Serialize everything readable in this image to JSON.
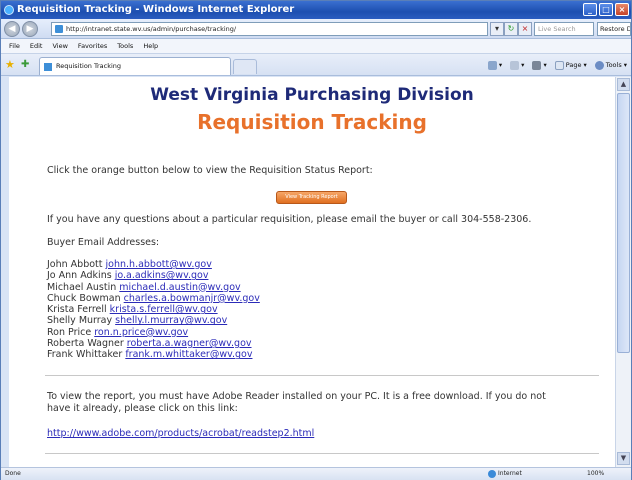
{
  "window": {
    "title": "Requisition Tracking - Windows Internet Explorer"
  },
  "address_bar": {
    "url": "http://intranet.state.wv.us/admin/purchase/tracking/",
    "search_placeholder": "Live Search",
    "restore_label": "Restore Do"
  },
  "menu": [
    "File",
    "Edit",
    "View",
    "Favorites",
    "Tools",
    "Help"
  ],
  "tab": {
    "label": "Requisition Tracking"
  },
  "command_bar": {
    "page_label": "Page",
    "tools_label": "Tools"
  },
  "page": {
    "org_title": "West Virginia Purchasing Division",
    "heading": "Requisition Tracking",
    "instruction": "Click the orange button below to view the Requisition Status Report:",
    "report_button": "View Tracking Report",
    "question_text": "If you have any questions about a particular requisition,  please email the buyer or call 304-558-2306.",
    "buyers_heading": "Buyer Email Addresses:",
    "buyers": [
      {
        "name": "John Abbott",
        "email": "john.h.abbott@wv.gov"
      },
      {
        "name": "Jo Ann Adkins",
        "email": "jo.a.adkins@wv.gov"
      },
      {
        "name": "Michael Austin",
        "email": "michael.d.austin@wv.gov"
      },
      {
        "name": "Chuck Bowman",
        "email": "charles.a.bowmanjr@wv.gov"
      },
      {
        "name": "Krista Ferrell",
        "email": "krista.s.ferrell@wv.gov"
      },
      {
        "name": "Shelly Murray",
        "email": "shelly.l.murray@wv.gov"
      },
      {
        "name": "Ron Price",
        "email": "ron.n.price@wv.gov"
      },
      {
        "name": "Roberta Wagner",
        "email": "roberta.a.wagner@wv.gov"
      },
      {
        "name": "Frank Whittaker",
        "email": "frank.m.whittaker@wv.gov"
      }
    ],
    "reader_text_1": "To view the report, you must have Adobe Reader installed on your PC. It is a free download.  If you do not",
    "reader_text_2": "have it already, please click on this link:",
    "adobe_link": "http://www.adobe.com/products/acrobat/readstep2.html"
  },
  "status_bar": {
    "status": "Done",
    "zone": "Internet",
    "zoom": "100%"
  }
}
